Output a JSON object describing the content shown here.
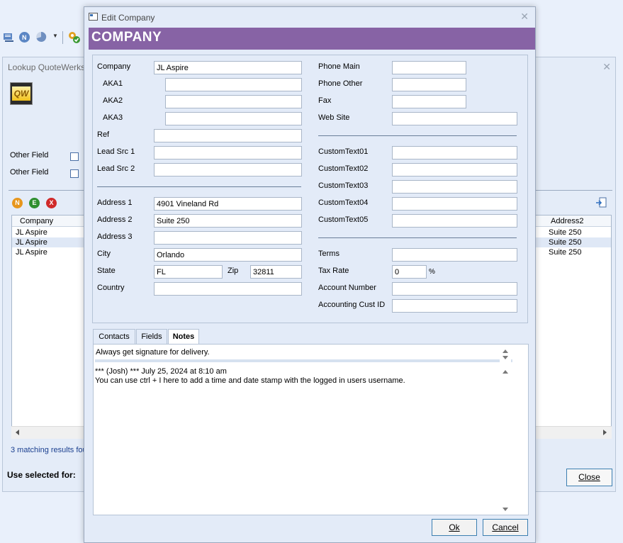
{
  "background": {
    "lookup_title": "Lookup QuoteWerks",
    "other_field_1": "Other Field",
    "other_field_2": "Other Field",
    "grid": {
      "col_company": "Company",
      "col_address2": "Address2",
      "rows": [
        {
          "company": "JL Aspire",
          "address2": "Suite 250"
        },
        {
          "company": "JL Aspire",
          "address2": "Suite 250"
        },
        {
          "company": "JL Aspire",
          "address2": "Suite 250"
        }
      ]
    },
    "results_text": "3 matching results fou",
    "use_selected_for": "Use selected for:",
    "close_label": "Close",
    "action_buttons": {
      "n": "N",
      "e": "E",
      "x": "X"
    }
  },
  "dialog": {
    "title": "Edit Company",
    "banner": "COMPANY",
    "left": {
      "company_label": "Company",
      "company_value": "JL Aspire",
      "aka1_label": "AKA1",
      "aka1_value": "",
      "aka2_label": "AKA2",
      "aka2_value": "",
      "aka3_label": "AKA3",
      "aka3_value": "",
      "ref_label": "Ref",
      "ref_value": "",
      "leadsrc1_label": "Lead Src 1",
      "leadsrc1_value": "",
      "leadsrc2_label": "Lead Src 2",
      "leadsrc2_value": "",
      "address1_label": "Address 1",
      "address1_value": "4901 Vineland Rd",
      "address2_label": "Address 2",
      "address2_value": "Suite 250",
      "address3_label": "Address 3",
      "address3_value": "",
      "city_label": "City",
      "city_value": "Orlando",
      "state_label": "State",
      "state_value": "FL",
      "zip_label": "Zip",
      "zip_value": "32811",
      "country_label": "Country",
      "country_value": ""
    },
    "right": {
      "phone_main_label": "Phone Main",
      "phone_main_value": "",
      "phone_other_label": "Phone Other",
      "phone_other_value": "",
      "fax_label": "Fax",
      "fax_value": "",
      "website_label": "Web Site",
      "website_value": "",
      "ct01_label": "CustomText01",
      "ct01_value": "",
      "ct02_label": "CustomText02",
      "ct02_value": "",
      "ct03_label": "CustomText03",
      "ct03_value": "",
      "ct04_label": "CustomText04",
      "ct04_value": "",
      "ct05_label": "CustomText05",
      "ct05_value": "",
      "terms_label": "Terms",
      "terms_value": "",
      "taxrate_label": "Tax Rate",
      "taxrate_value": "0",
      "taxrate_unit": "%",
      "account_number_label": "Account Number",
      "account_number_value": "",
      "accounting_cust_id_label": "Accounting Cust ID",
      "accounting_cust_id_value": ""
    },
    "tabs": {
      "contacts": "Contacts",
      "fields": "Fields",
      "notes": "Notes"
    },
    "notes": {
      "top_note": "Always get signature for delivery.",
      "entry_header": "*** (Josh) ***  July 25, 2024 at 8:10 am",
      "entry_text": "You can use ctrl + I here to add a time and date stamp with the logged in users username."
    },
    "ok_label": "Ok",
    "cancel_label": "Cancel"
  }
}
